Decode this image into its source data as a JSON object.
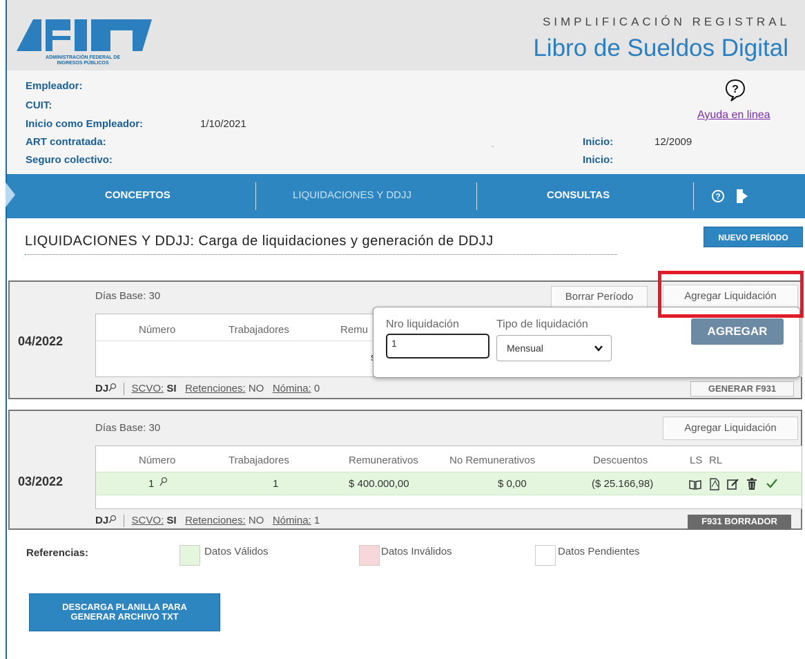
{
  "header": {
    "logo_text": "AFIP",
    "logo_subtitle_line1": "ADMINISTRACIÓN FEDERAL DE",
    "logo_subtitle_line2": "INGRESOS PÚBLICOS",
    "program": "SIMPLIFICACIÓN REGISTRAL",
    "title": "Libro de Sueldos Digital"
  },
  "employer": {
    "empleador_label": "Empleador:",
    "cuit_label": "CUIT:",
    "inicio_empleador_label": "Inicio como Empleador:",
    "inicio_empleador_value": "1/10/2021",
    "art_label": "ART contratada:",
    "seguro_label": "Seguro colectivo:",
    "art_inicio_label": "Inicio:",
    "art_inicio_value": "12/2009",
    "seguro_inicio_label": "Inicio:",
    "separator": "-"
  },
  "help": {
    "link": "Ayuda en linea"
  },
  "nav": {
    "items": [
      "CONCEPTOS",
      "LIQUIDACIONES Y DDJJ",
      "CONSULTAS"
    ],
    "help_icon": "question-circle-icon",
    "exit_icon": "exit-door-icon"
  },
  "page": {
    "title": "LIQUIDACIONES Y DDJJ: Carga de liquidaciones y generación de DDJJ",
    "new_period_button": "NUEVO PERÍODO"
  },
  "periods": [
    {
      "period": "04/2022",
      "dias_base": "Días Base: 30",
      "borrar": "Borrar Período",
      "agregar_liquidacion": "Agregar Liquidación",
      "headers": [
        "Número",
        "Trabajadores",
        "Remu"
      ],
      "truncated_cell": "s",
      "footer": {
        "dj": "DJ",
        "scvo_label": "SCVO:",
        "scvo_value": "SI",
        "ret_label": "Retenciones:",
        "ret_value": "NO",
        "nomina_label": "Nómina:",
        "nomina_value": "0"
      },
      "action": "GENERAR F931"
    },
    {
      "period": "03/2022",
      "dias_base": "Días Base: 30",
      "agregar_liquidacion": "Agregar Liquidación",
      "headers": [
        "Número",
        "Trabajadores",
        "Remunerativos",
        "No Remunerativos",
        "Descuentos",
        "LS",
        "RL"
      ],
      "row": {
        "numero": "1",
        "trabajadores": "1",
        "remunerativos": "$ 400.000,00",
        "no_remunerativos": "$ 0,00",
        "descuentos": "($ 25.166,98)"
      },
      "footer": {
        "dj": "DJ",
        "scvo_label": "SCVO:",
        "scvo_value": "SI",
        "ret_label": "Retenciones:",
        "ret_value": "NO",
        "nomina_label": "Nómina:",
        "nomina_value": "1"
      },
      "action": "F931 BORRADOR"
    }
  ],
  "popup": {
    "nro_label": "Nro liquidación",
    "nro_value": "1",
    "tipo_label": "Tipo de liquidación",
    "tipo_selected": "Mensual",
    "agregar_button": "AGREGAR"
  },
  "references": {
    "label": "Referencias:",
    "items": [
      {
        "text": "Datos Válidos",
        "color": "#e4f6dd"
      },
      {
        "text": "Datos Inválidos",
        "color": "#f8d7da"
      },
      {
        "text": "Datos Pendientes",
        "color": "#ffffff"
      }
    ]
  },
  "download_button": {
    "line1": "DESCARGA PLANILLA PARA",
    "line2": "GENERAR ARCHIVO TXT"
  },
  "colors": {
    "primary": "#2e86c1",
    "highlight": "#e21b2b",
    "valid": "#e4f6dd"
  }
}
